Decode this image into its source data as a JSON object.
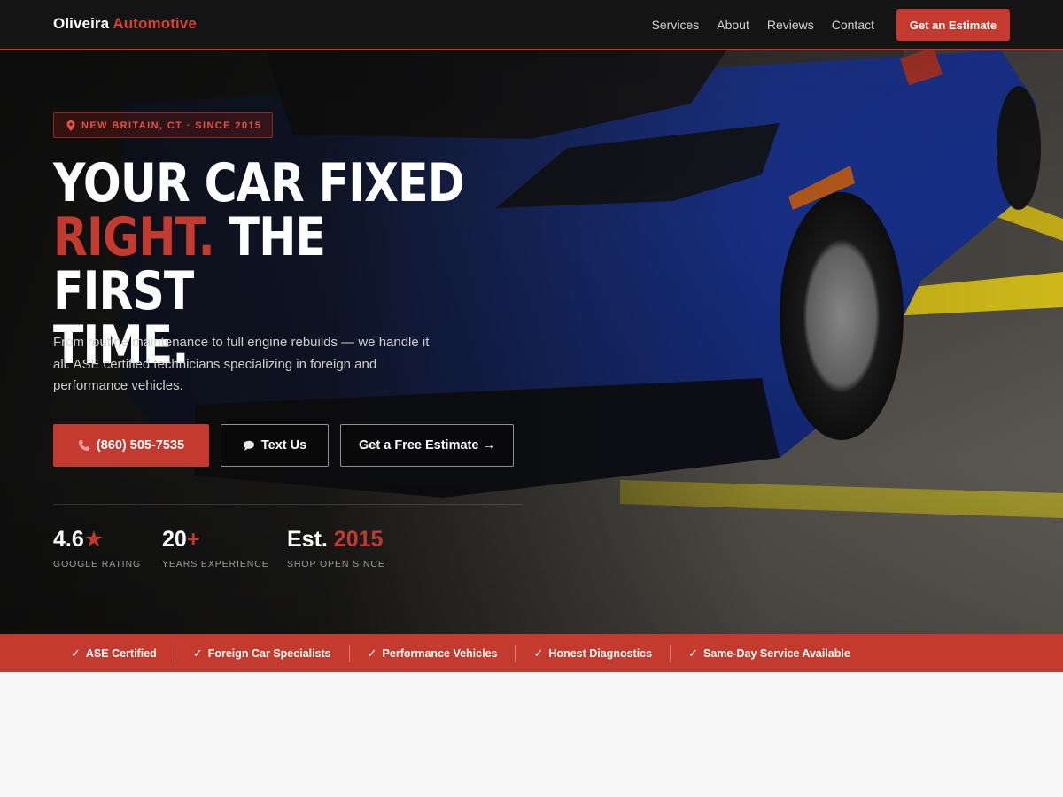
{
  "nav": {
    "brand_main": "Oliveira",
    "brand_accent": "Automotive",
    "links": [
      "Services",
      "About",
      "Reviews",
      "Contact"
    ],
    "cta": "Get an Estimate"
  },
  "hero": {
    "badge": "NEW BRITAIN, CT · SINCE 2015",
    "headline_line1": "YOUR CAR FIXED",
    "headline_red": "RIGHT.",
    "headline_line2_rest": " THE FIRST",
    "headline_line3": "TIME.",
    "lead": "From routine maintenance to full engine rebuilds — we handle it all. ASE certified technicians specializing in foreign and performance vehicles.",
    "buttons": {
      "call": "(860) 505-7535",
      "text": "Text Us",
      "estimate": "Get a Free Estimate →"
    },
    "stats": [
      {
        "value": "4.6",
        "accent": "★",
        "label": "GOOGLE RATING"
      },
      {
        "value": "20",
        "accent": "+",
        "label": "YEARS EXPERIENCE"
      },
      {
        "value": "Est. ",
        "accent": "2015",
        "label": "SHOP OPEN SINCE"
      }
    ]
  },
  "trust_bar": [
    "ASE Certified",
    "Foreign Car Specialists",
    "Performance Vehicles",
    "Honest Diagnostics",
    "Same-Day Service Available"
  ],
  "colors": {
    "accent": "#c53a2e",
    "nav_bg": "#141414",
    "car_blue": "#1f3fa8"
  },
  "icons": {
    "badge": "map-pin-icon",
    "call": "phone-icon",
    "text": "chat-bubble-icon",
    "trust": "check-icon"
  }
}
